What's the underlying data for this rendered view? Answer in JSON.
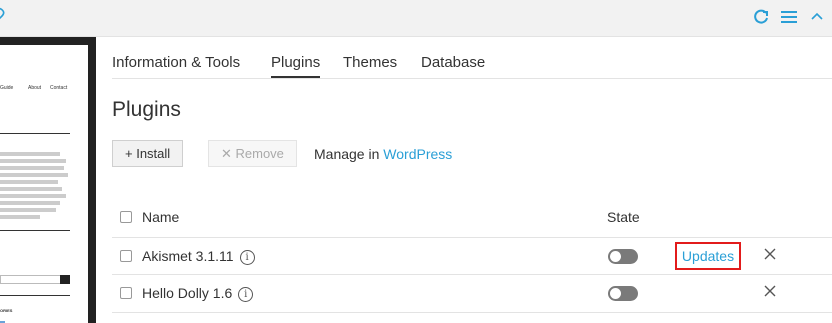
{
  "topbar": {
    "icons": [
      "logo-icon",
      "refresh-icon",
      "menu-icon",
      "collapse-icon"
    ],
    "accent_color": "#2a9fd6"
  },
  "preview": {
    "nav_items": [
      "Guide",
      "About",
      "Contact"
    ],
    "categories_label": "ORIES"
  },
  "tabs": [
    "Information & Tools",
    "Plugins",
    "Themes",
    "Database"
  ],
  "active_tab": "Plugins",
  "page_title": "Plugins",
  "toolbar": {
    "install_label": "+ Install",
    "remove_label": "✕ Remove",
    "manage_prefix": "Manage in ",
    "manage_link": "WordPress"
  },
  "table": {
    "columns": {
      "name": "Name",
      "state": "State"
    },
    "rows": [
      {
        "name": "Akismet 3.1.11",
        "info_glyph": "i",
        "state": "off",
        "action": "Updates"
      },
      {
        "name": "Hello Dolly 1.6",
        "info_glyph": "i",
        "state": "off",
        "action": ""
      }
    ]
  },
  "colors": {
    "link": "#2a9fd6",
    "highlight": "#e21b1b",
    "toggle_off": "#7a7a7a"
  }
}
